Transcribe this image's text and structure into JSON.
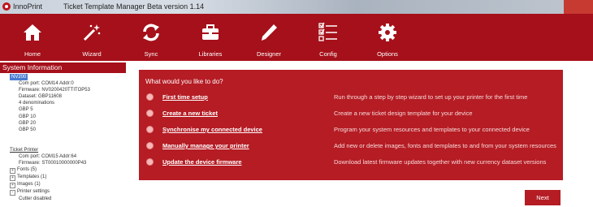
{
  "titlebar": {
    "app_name": "InnoPrint",
    "window_title": "Ticket Template Manager Beta version 1.14"
  },
  "ribbon": {
    "items": [
      {
        "label": "Home",
        "icon": "home-icon"
      },
      {
        "label": "Wizard",
        "icon": "wand-icon"
      },
      {
        "label": "Sync",
        "icon": "sync-icon"
      },
      {
        "label": "Libraries",
        "icon": "briefcase-icon"
      },
      {
        "label": "Designer",
        "icon": "pen-icon"
      },
      {
        "label": "Config",
        "icon": "checklist-icon"
      },
      {
        "label": "Options",
        "icon": "gear-icon"
      }
    ]
  },
  "system_info": {
    "header": "System Information",
    "device": "NV200",
    "device_lines": [
      "Com port: COM14 Addr:0",
      "Firmware: NV0200420TTITOP53",
      "Dataset: GBP11608",
      "4 denominations",
      "GBP 5",
      "GBP 10",
      "GBP 20",
      "GBP 50"
    ],
    "printer_title": "Ticket Printer",
    "printer_lines": [
      "Com port: COM15 Addr:64",
      "Firmware: ST00010000000P43"
    ],
    "printer_nodes": [
      {
        "expander": "+",
        "label": "Fonts (5)"
      },
      {
        "expander": "+",
        "label": "Templates (1)"
      },
      {
        "expander": "+",
        "label": "Images (1)"
      },
      {
        "expander": "-",
        "label": "Printer settings"
      }
    ],
    "printer_setting": "Cutter disabled"
  },
  "main": {
    "heading": "What would you like to do?",
    "options": [
      {
        "title": "First time setup",
        "description": "Run through a step by step wizard to set up your printer for the first time"
      },
      {
        "title": "Create a new ticket",
        "description": "Create a new ticket design template for your device"
      },
      {
        "title": "Synchronise my connected device",
        "description": "Program your system resources and templates to your connected device"
      },
      {
        "title": "Manually manage your printer",
        "description": "Add new or delete images, fonts and templates to and from your system resources"
      },
      {
        "title": "Update the device firmware",
        "description": "Download latest firmware updates together with new currency dataset versions"
      }
    ],
    "next_label": "Next"
  },
  "colors": {
    "ribbon": "#a5101a",
    "panel": "#b51c24",
    "selection": "#4a7bd1"
  }
}
